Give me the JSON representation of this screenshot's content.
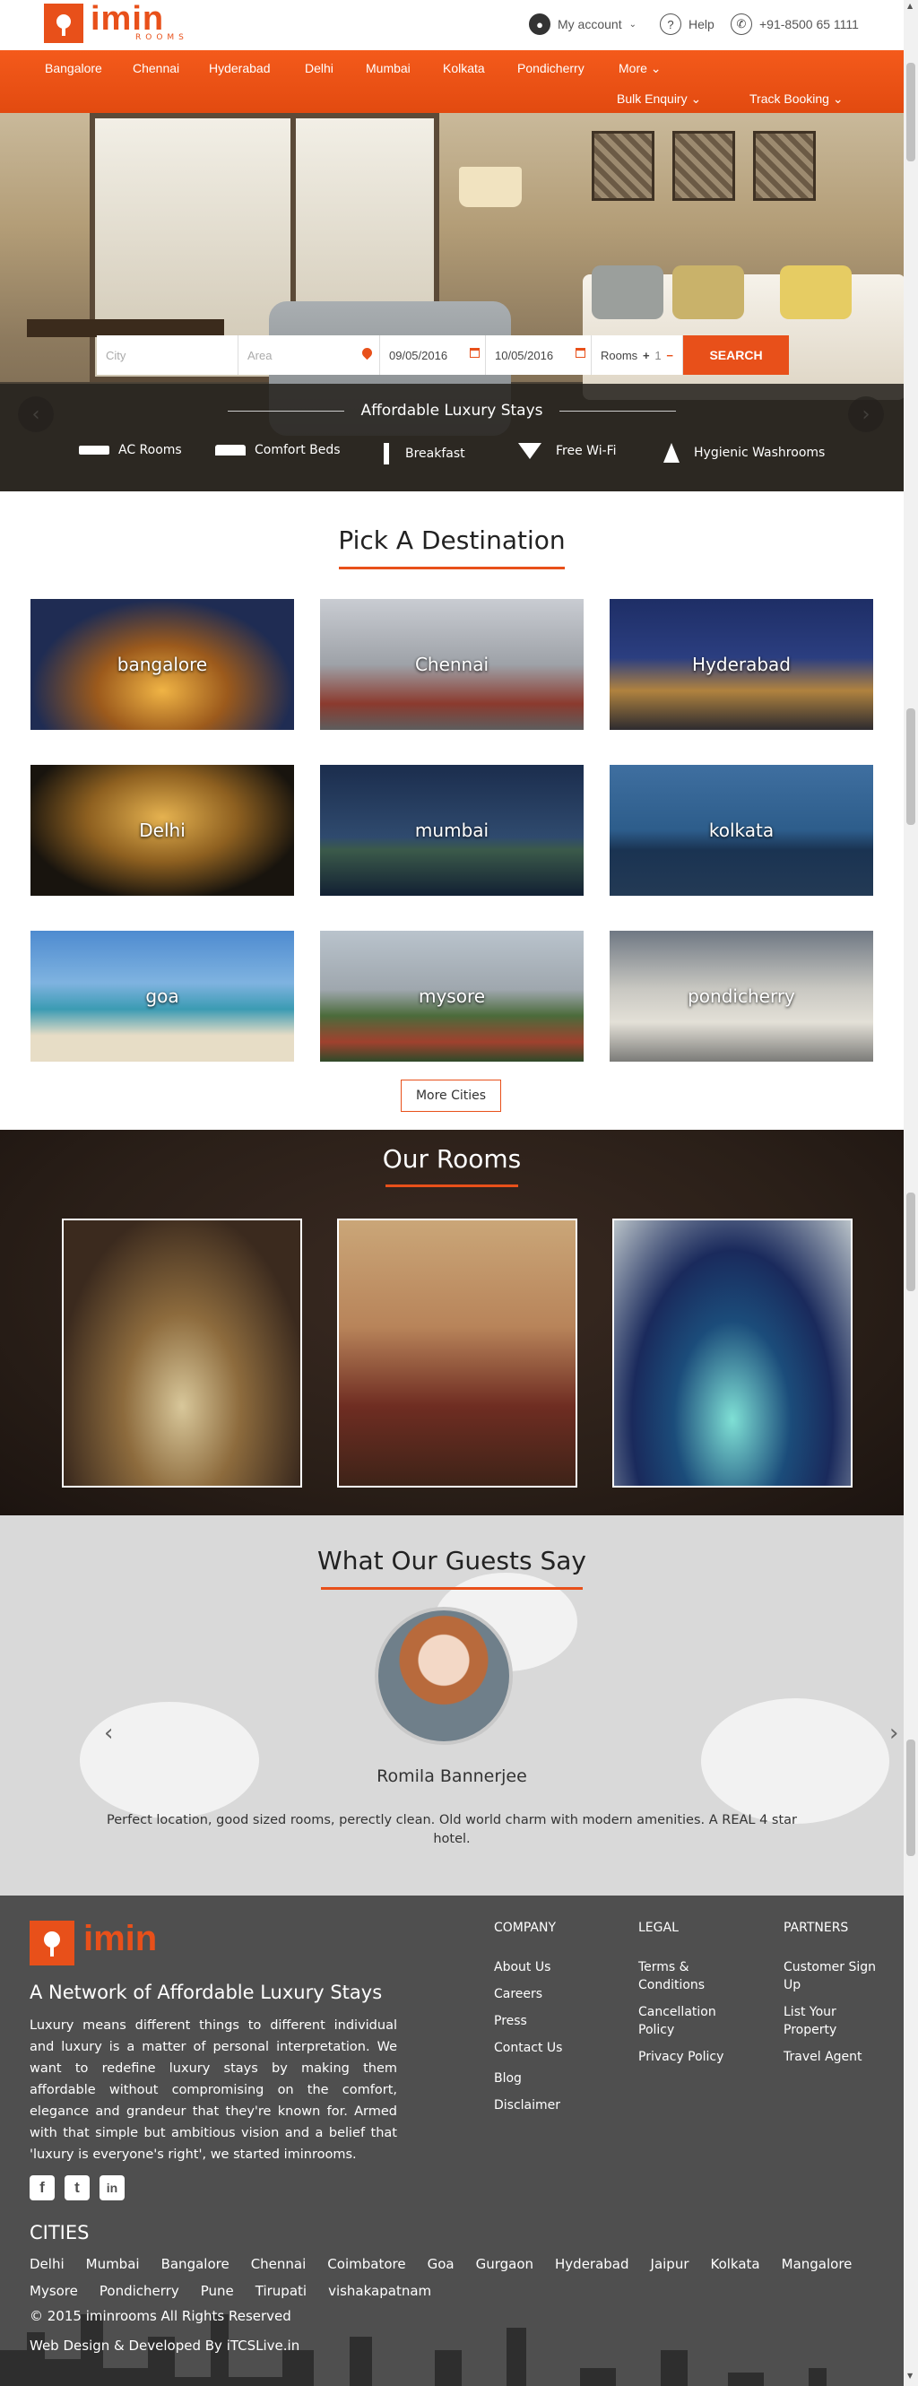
{
  "header": {
    "logo_text": "imin",
    "logo_sub": "ROOMS",
    "account_label": "My account",
    "help_label": "Help",
    "phone": "+91-8500 65 1111"
  },
  "nav": {
    "cities": [
      "Bangalore",
      "Chennai",
      "Hyderabad",
      "Delhi",
      "Mumbai",
      "Kolkata",
      "Pondicherry"
    ],
    "more_label": "More",
    "bulk_enquiry": "Bulk Enquiry",
    "track_booking": "Track Booking"
  },
  "search": {
    "city_placeholder": "City",
    "area_placeholder": "Area",
    "checkin": "09/05/2016",
    "checkout": "10/05/2016",
    "rooms_label": "Rooms",
    "rooms_plus": "+",
    "rooms_value": "1",
    "rooms_minus": "−",
    "search_label": "SEARCH"
  },
  "hero": {
    "prev": "‹",
    "next": "›",
    "amenities_title": "Affordable Luxury Stays",
    "amenities": [
      "AC Rooms",
      "Comfort Beds",
      "Breakfast",
      "Free Wi-Fi",
      "Hygienic Washrooms"
    ]
  },
  "destinations": {
    "title": "Pick A Destination",
    "cities": [
      "bangalore",
      "Chennai",
      "Hyderabad",
      "Delhi",
      "mumbai",
      "kolkata",
      "goa",
      "mysore",
      "pondicherry"
    ],
    "more_label": "More Cities"
  },
  "rooms": {
    "title": "Our Rooms"
  },
  "guests": {
    "title": "What Our Guests Say",
    "name": "Romila Bannerjee",
    "quote": "Perfect location, good sized rooms, perectly clean. Old world charm with modern amenities. A REAL 4 star hotel.",
    "prev": "‹",
    "next": "›"
  },
  "footer": {
    "logo_text": "imin",
    "tagline": "A Network of Affordable Luxury Stays",
    "description": "Luxury means different things to different individual and luxury is a matter of personal interpretation. We want to redefine luxury stays by making them affordable without compromising on the comfort, elegance and grandeur that they're known for. Armed with that simple but ambitious vision and a belief that 'luxury is everyone's right', we started iminrooms.",
    "social": [
      "f",
      "t",
      "in"
    ],
    "company_title": "COMPANY",
    "company_links": [
      "About Us",
      "Careers",
      "Press",
      "Contact Us",
      "Blog",
      "Disclaimer"
    ],
    "legal_title": "LEGAL",
    "legal_links": [
      "Terms & Conditions",
      "Cancellation Policy",
      "Privacy Policy"
    ],
    "partners_title": "PARTNERS",
    "partners_links": [
      "Customer Sign Up",
      "List Your Property",
      "Travel Agent"
    ],
    "cities_title": "CITIES",
    "cities": [
      "Delhi",
      "Mumbai",
      "Bangalore",
      "Chennai",
      "Coimbatore",
      "Goa",
      "Gurgaon",
      "Hyderabad",
      "Jaipur",
      "Kolkata",
      "Mangalore",
      "Mysore",
      "Pondicherry",
      "Pune",
      "Tirupati",
      "vishakapatnam"
    ],
    "copyright": "© 2015 iminrooms All Rights Reserved",
    "developer": "Web Design & Developed By iTCSLive.in"
  },
  "colors": {
    "accent": "#e8501a",
    "footer_bg": "#4f4f4f",
    "guests_bg": "#d9d9d9"
  }
}
